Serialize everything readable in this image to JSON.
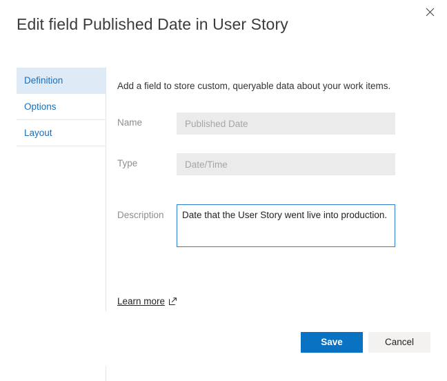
{
  "dialog": {
    "title": "Edit field Published Date in User Story",
    "close_icon": "close-icon",
    "close_label": "Close"
  },
  "pivot": {
    "items": [
      {
        "label": "Definition",
        "selected": true
      },
      {
        "label": "Options",
        "selected": false
      },
      {
        "label": "Layout",
        "selected": false
      }
    ]
  },
  "definition": {
    "intro": "Add a field to store custom, queryable data about your work items.",
    "fields": {
      "name": {
        "label": "Name",
        "value": "Published Date",
        "placeholder": "Published Date"
      },
      "type": {
        "label": "Type",
        "value": "Date/Time",
        "placeholder": "Date/Time"
      },
      "description": {
        "label": "Description",
        "value": "Date that the User Story went live into production.",
        "placeholder": "Description"
      }
    },
    "learn_more": {
      "label": "Learn more",
      "icon": "external-link-icon"
    }
  },
  "footer": {
    "save_label": "Save",
    "cancel_label": "Cancel"
  },
  "colors": {
    "accent": "#0a72c3",
    "pivot_selected_bg": "#deebf7",
    "pivot_text": "#1b6eb5",
    "input_disabled_bg": "#ebebeb",
    "focus_border": "#2b7cd3",
    "secondary_button_bg": "#f3f2f1"
  }
}
